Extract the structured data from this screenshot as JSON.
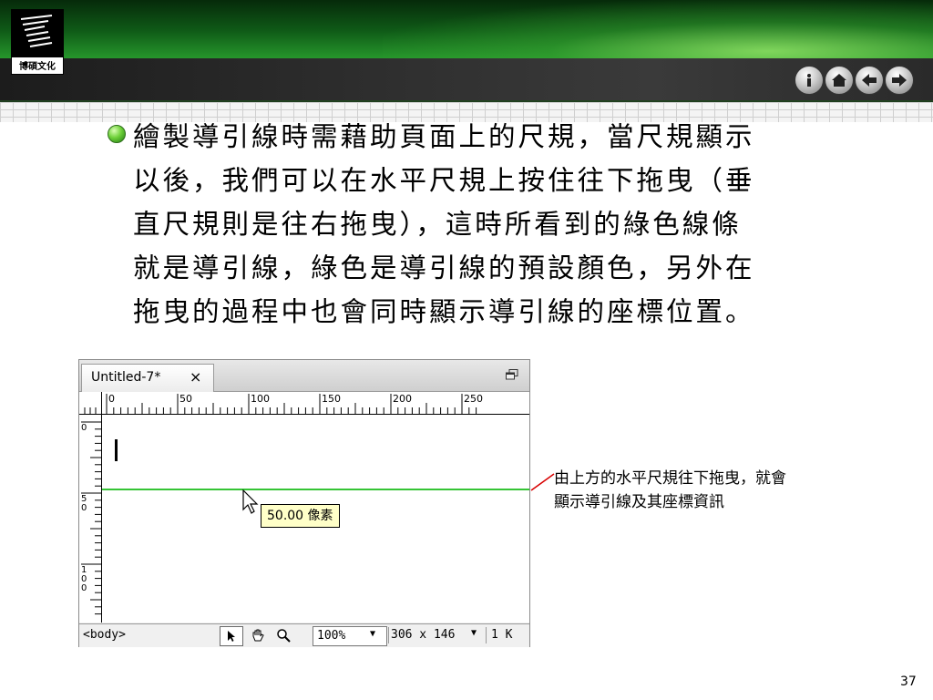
{
  "header": {
    "logo_text": "博碩文化",
    "nav_buttons": [
      {
        "icon": "info-icon"
      },
      {
        "icon": "home-icon"
      },
      {
        "icon": "back-arrow-icon"
      },
      {
        "icon": "forward-arrow-icon"
      }
    ]
  },
  "body": {
    "paragraph": "繪製導引線時需藉助頁面上的尺規，當尺規顯示\n以後，我們可以在水平尺規上按住往下拖曳（垂\n直尺規則是往右拖曳），這時所看到的綠色線條\n就是導引線，綠色是導引線的預設顏色，另外在\n拖曳的過程中也會同時顯示導引線的座標位置。"
  },
  "editor": {
    "tab_title": "Untitled-7*",
    "tab_close": "×",
    "hruler_labels": [
      "0",
      "50",
      "100",
      "150",
      "200",
      "250"
    ],
    "vruler_labels": [
      "0",
      "5\n0",
      "1\n0\n0"
    ],
    "tooltip": "50.00 像素",
    "guide_color": "#35c435",
    "status": {
      "tag_selector": "<body>",
      "zoom": "100%",
      "window_size": "306 x 146",
      "page_size": "1 K"
    }
  },
  "annotation": {
    "text": "由上方的水平尺規往下拖曳，就會\n顯示導引線及其座標資訊",
    "line_color": "#d80000"
  },
  "page_number": "37"
}
